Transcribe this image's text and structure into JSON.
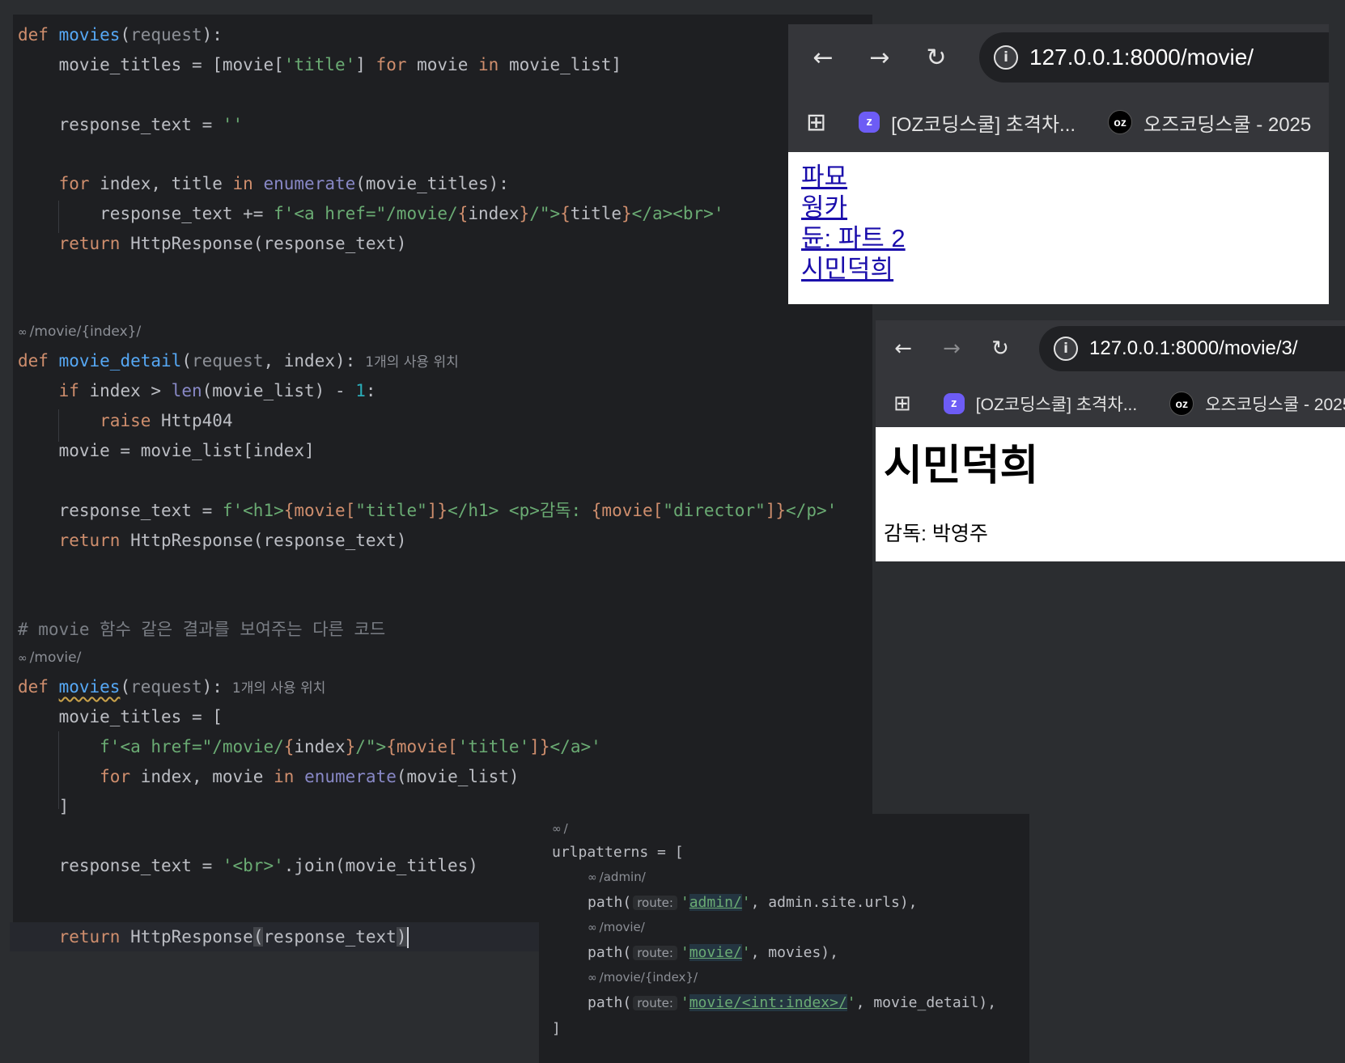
{
  "main_code": {
    "l1_def": "def",
    "l1_fn": "movies",
    "l1_param": "request",
    "l2": "movie_titles = [movie[",
    "l2_str": "'title'",
    "l2_b": "] ",
    "l2_for": "for",
    "l2_c": " movie ",
    "l2_in": "in",
    "l2_d": " movie_list]",
    "l3": "response_text = ",
    "l3_str": "''",
    "l4_for": "for",
    "l4_a": " index, title ",
    "l4_in": "in",
    "l4_enum": "enumerate",
    "l4_b": "(movie_titles):",
    "l5_a": "response_text += ",
    "l5_s1": "f'<a href=\"/movie/",
    "l5_b1": "{",
    "l5_v1": "index",
    "l5_b2": "}",
    "l5_s2": "/\">",
    "l5_b3": "{",
    "l5_v2": "title",
    "l5_b4": "}",
    "l5_s3": "</a><br>'",
    "l6_ret": "return",
    "l6_a": " HttpResponse(response_text)",
    "route_hint_1": "/movie/{index}/",
    "l7_def": "def",
    "l7_fn": "movie_detail",
    "l7_param": "request",
    "l7_b": ", index):",
    "l7_use": "1개의 사용 위치",
    "l8_if": "if",
    "l8_a": " index > ",
    "l8_len": "len",
    "l8_b": "(movie_list) - ",
    "l8_num": "1",
    "l8_c": ":",
    "l9_raise": "raise",
    "l9_a": " Http404",
    "l10": "movie = movie_list[index]",
    "l11_a": "response_text = ",
    "l11_s1": "f'<h1>",
    "l11_b1": "{movie[",
    "l11_s2": "\"title\"",
    "l11_b2": "]}",
    "l11_s3": "</h1> <p>감독: ",
    "l11_b3": "{movie[",
    "l11_s4": "\"director\"",
    "l11_b4": "]}",
    "l11_s5": "</p>'",
    "l12_ret": "return",
    "l12_a": " HttpResponse(response_text)",
    "comment": "# movie 함수 같은 결과를 보여주는 다른 코드",
    "route_hint_2": "/movie/",
    "l13_def": "def",
    "l13_fn": "movies",
    "l13_param": "request",
    "l13_use": "1개의 사용 위치",
    "l14": "movie_titles = [",
    "l15_s1": "f'<a href=\"/movie/",
    "l15_b1": "{",
    "l15_v1": "index",
    "l15_b2": "}",
    "l15_s2": "/\">",
    "l15_b3": "{movie[",
    "l15_s3": "'title'",
    "l15_b4": "]}",
    "l15_s4": "</a>'",
    "l16_for": "for",
    "l16_a": " index, movie ",
    "l16_in": "in",
    "l16_enum": "enumerate",
    "l16_b": "(movie_list)",
    "l17": "]",
    "l18_a": "response_text = ",
    "l18_s": "'<br>'",
    "l18_b": ".join(movie_titles)",
    "l19_ret": "return",
    "l19_a": " HttpResponse",
    "l19_p1": "(",
    "l19_b": "response_text",
    "l19_p2": ")"
  },
  "url_code": {
    "hint_root": "/",
    "l1": "urlpatterns = [",
    "hint_admin": "/admin/",
    "p_path": "path(",
    "route_label": "route:",
    "admin_q1": "'",
    "admin_val": "admin/",
    "admin_q2": "'",
    "admin_rest": ", admin.site.urls),",
    "hint_movie": "/movie/",
    "movie_q1": "'",
    "movie_val": "movie/",
    "movie_q2": "'",
    "movie_rest": ", movies),",
    "hint_detail": "/movie/{index}/",
    "detail_q1": "'",
    "detail_val": "movie/<int:index>/",
    "detail_q2": "'",
    "detail_rest": ", movie_detail),",
    "close": "]"
  },
  "browser_list": {
    "url": "127.0.0.1:8000/movie/",
    "bookmark_1": "[OZ코딩스쿨] 초격차...",
    "bookmark_1_icon": "z",
    "bookmark_2": "오즈코딩스쿨 - 2025",
    "bookmark_2_icon": "oz",
    "links": [
      "파묘",
      "웡카",
      "듄: 파트 2",
      "시민덕희"
    ]
  },
  "browser_detail": {
    "url": "127.0.0.1:8000/movie/3/",
    "bookmark_1": "[OZ코딩스쿨] 초격차...",
    "bookmark_1_icon": "z",
    "bookmark_2": "오즈코딩스쿨 - 2025",
    "bookmark_2_icon": "oz",
    "title": "시민덕희",
    "director": "감독: 박영주"
  },
  "colors": {
    "keyword": "#cf8e6d",
    "function": "#56a8f5",
    "string": "#6aab73",
    "link": "#1a0dab",
    "editor_bg": "#1e1f22"
  }
}
